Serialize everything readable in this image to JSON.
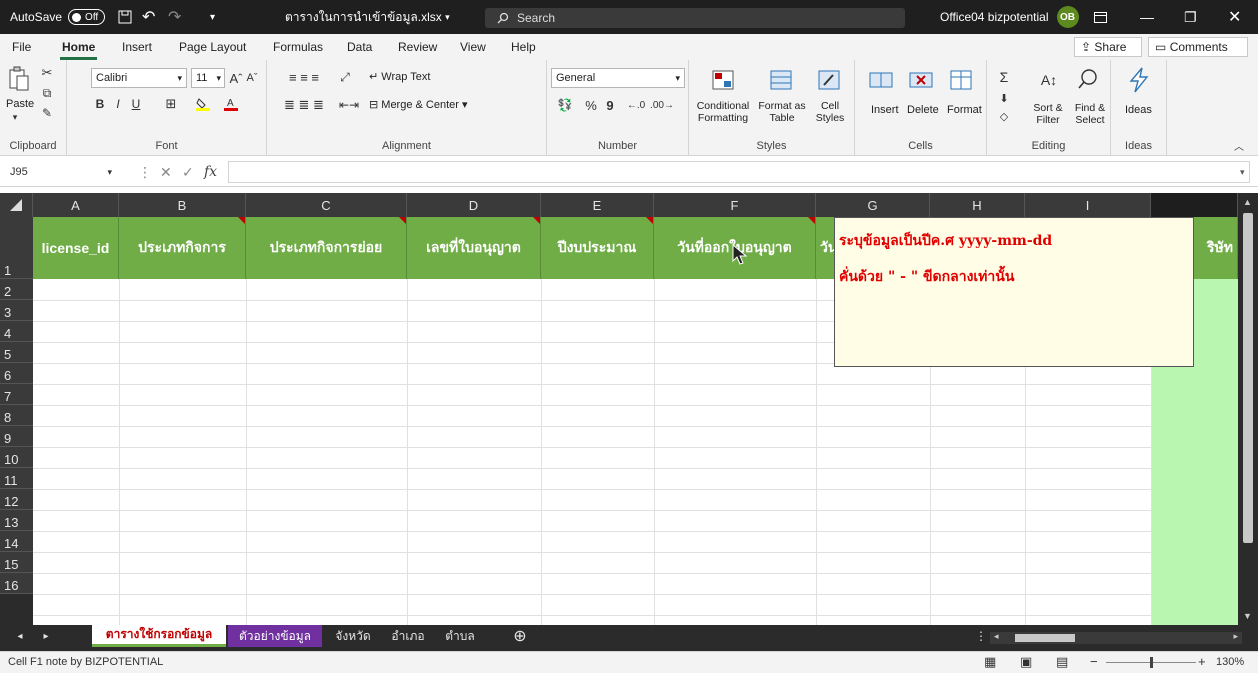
{
  "titlebar": {
    "autosave_label": "AutoSave",
    "autosave_state": "Off",
    "filename": "ตารางในการนำเข้าข้อมูล.xlsx",
    "search_placeholder": "Search",
    "account": "Office04 bizpotential",
    "account_initials": "OB"
  },
  "menu": {
    "tabs": [
      "File",
      "Home",
      "Insert",
      "Page Layout",
      "Formulas",
      "Data",
      "Review",
      "View",
      "Help"
    ],
    "share_label": "Share",
    "comments_label": "Comments"
  },
  "ribbon": {
    "clipboard": {
      "label": "Clipboard",
      "paste": "Paste"
    },
    "font": {
      "label": "Font",
      "name": "Calibri",
      "size": "11",
      "bold": "B",
      "italic": "I",
      "underline": "U"
    },
    "alignment": {
      "label": "Alignment",
      "wrap": "Wrap Text",
      "merge": "Merge & Center"
    },
    "number": {
      "label": "Number",
      "format": "General",
      "percent": "%",
      "comma": "9"
    },
    "styles": {
      "label": "Styles",
      "conditional": "Conditional Formatting",
      "format_table": "Format as Table",
      "cell_styles": "Cell Styles"
    },
    "cells": {
      "label": "Cells",
      "insert": "Insert",
      "delete": "Delete",
      "format": "Format"
    },
    "editing": {
      "label": "Editing",
      "sort": "Sort & Filter",
      "find": "Find & Select"
    },
    "ideas": {
      "label": "Ideas",
      "button": "Ideas"
    }
  },
  "formula_bar": {
    "name_box": "J95",
    "fx": "fx",
    "value": ""
  },
  "grid": {
    "columns": [
      "A",
      "B",
      "C",
      "D",
      "E",
      "F",
      "G",
      "H",
      "I"
    ],
    "rows": [
      "1",
      "2",
      "3",
      "4",
      "5",
      "6",
      "7",
      "8",
      "9",
      "10",
      "11",
      "12",
      "13",
      "14",
      "15",
      "16"
    ],
    "headers": [
      "license_id",
      "ประเภทกิจการ",
      "ประเภทกิจการย่อย",
      "เลขที่ใบอนุญาต",
      "ปีงบประมาณ",
      "วันที่ออกใบอนุญาต",
      "วัน",
      "",
      "",
      "ริษัท"
    ]
  },
  "comment": {
    "line1": "ระบุข้อมูลเป็นปีค.ศ yyyy-mm-dd",
    "line2": "คั่นด้วย \" - \" ขีดกลางเท่านั้น"
  },
  "sheets": {
    "tabs": [
      "ตารางใช้กรอกข้อมูล",
      "ตัวอย่างข้อมูล",
      "จังหวัด",
      "อำเภอ",
      "ตำบล"
    ],
    "add": "⊕"
  },
  "status": {
    "text": "Cell F1 note by BIZPOTENTIAL",
    "zoom": "130%"
  },
  "colors": {
    "header_green": "#70ad47",
    "note_red": "#e00000",
    "tab_purple": "#7030a0"
  }
}
